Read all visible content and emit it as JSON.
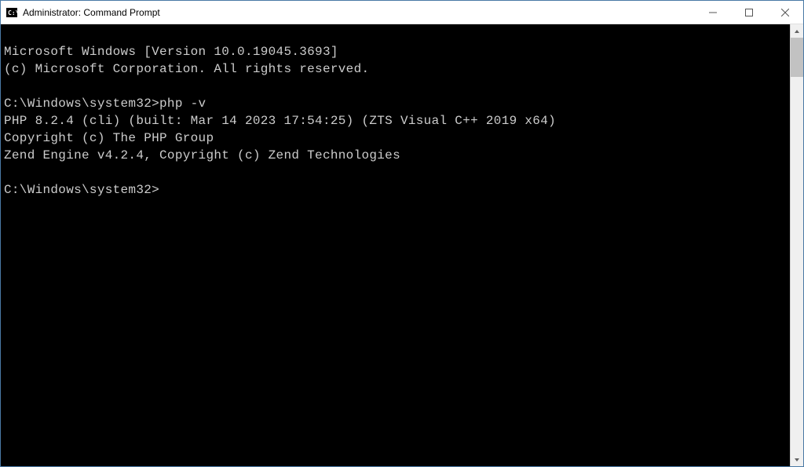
{
  "window": {
    "title": "Administrator: Command Prompt"
  },
  "terminal": {
    "lines": [
      "Microsoft Windows [Version 10.0.19045.3693]",
      "(c) Microsoft Corporation. All rights reserved.",
      "",
      "C:\\Windows\\system32>php -v",
      "PHP 8.2.4 (cli) (built: Mar 14 2023 17:54:25) (ZTS Visual C++ 2019 x64)",
      "Copyright (c) The PHP Group",
      "Zend Engine v4.2.4, Copyright (c) Zend Technologies",
      "",
      "C:\\Windows\\system32>"
    ]
  }
}
